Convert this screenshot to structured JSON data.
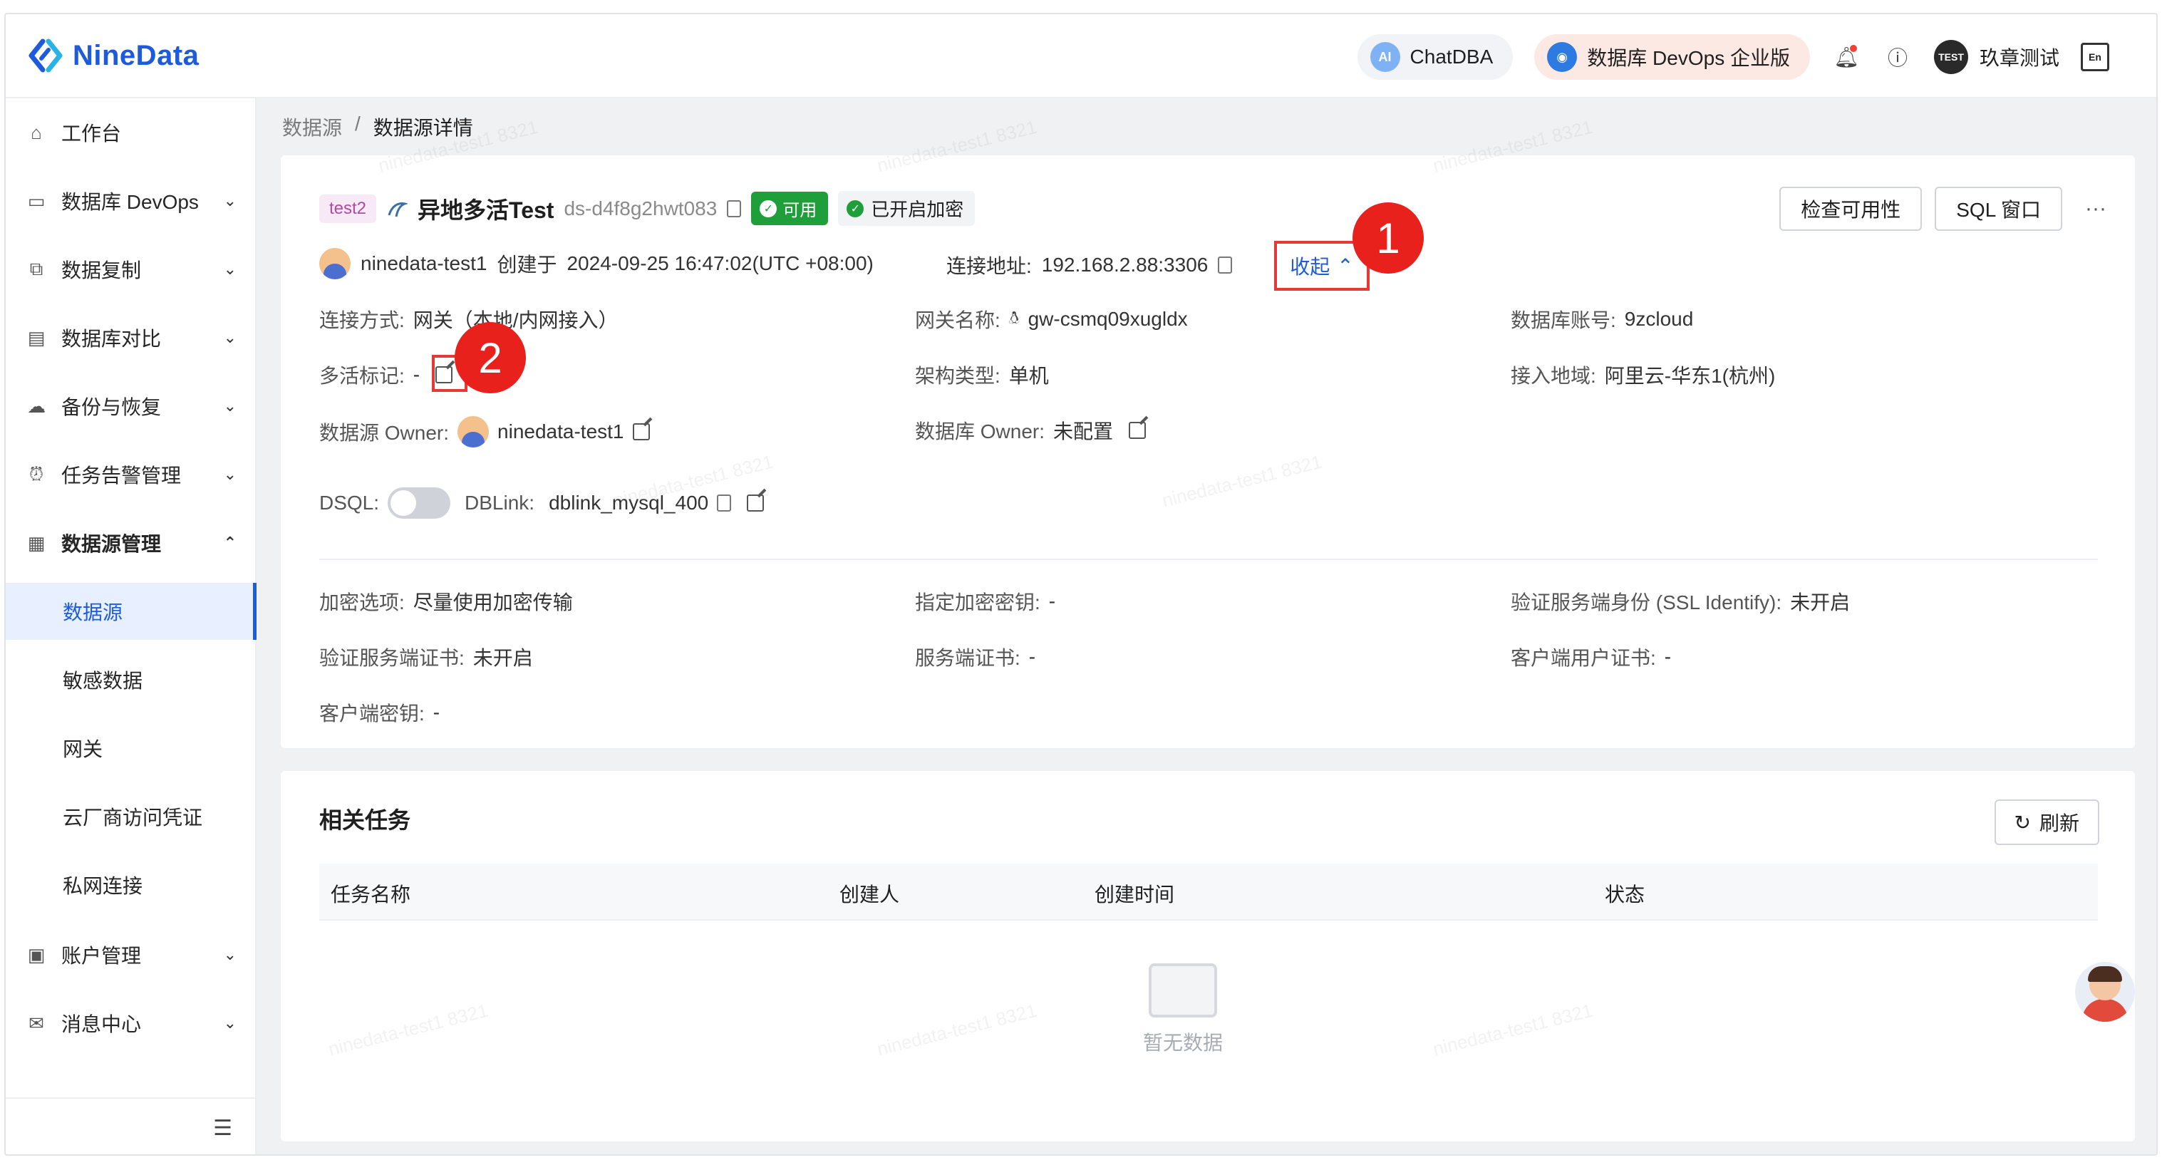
{
  "brand": {
    "name": "NineData"
  },
  "topbar": {
    "chatdba_label": "ChatDBA",
    "chatdba_badge": "AI",
    "devops_label": "数据库 DevOps 企业版",
    "user_badge": "TEST",
    "user_name": "玖章测试"
  },
  "sidebar": {
    "items": [
      {
        "label": "工作台",
        "icon": "home-icon",
        "chevron": ""
      },
      {
        "label": "数据库 DevOps",
        "icon": "devops-icon",
        "chevron": "⌄"
      },
      {
        "label": "数据复制",
        "icon": "replication-icon",
        "chevron": "⌄"
      },
      {
        "label": "数据库对比",
        "icon": "compare-icon",
        "chevron": "⌄"
      },
      {
        "label": "备份与恢复",
        "icon": "backup-icon",
        "chevron": "⌄"
      },
      {
        "label": "任务告警管理",
        "icon": "alarm-icon",
        "chevron": "⌄"
      },
      {
        "label": "数据源管理",
        "icon": "datasource-icon",
        "chevron": "⌃"
      }
    ],
    "sub_items": [
      {
        "label": "数据源",
        "active": true
      },
      {
        "label": "敏感数据"
      },
      {
        "label": "网关"
      },
      {
        "label": "云厂商访问凭证"
      },
      {
        "label": "私网连接"
      }
    ],
    "bottom_items": [
      {
        "label": "账户管理",
        "icon": "account-icon",
        "chevron": "⌄"
      },
      {
        "label": "消息中心",
        "icon": "mail-icon",
        "chevron": "⌄"
      }
    ]
  },
  "breadcrumb": {
    "root": "数据源",
    "sep": "/",
    "current": "数据源详情"
  },
  "datasource": {
    "env_tag": "test2",
    "name": "异地多活Test",
    "id": "ds-d4f8g2hwt083",
    "status": "可用",
    "encryption": "已开启加密",
    "creator": "ninedata-test1",
    "created_label": "创建于",
    "created_at": "2024-09-25 16:47:02(UTC +08:00)",
    "conn_label": "连接地址:",
    "conn_addr": "192.168.2.88:3306",
    "collapse_label": "收起"
  },
  "header_buttons": {
    "check": "检查可用性",
    "sql": "SQL 窗口",
    "more": "···"
  },
  "fields": {
    "conn_mode": {
      "label": "连接方式:",
      "value": "网关（本地/内网接入）"
    },
    "gateway": {
      "label": "网关名称:",
      "value": "gw-csmq09xugldx"
    },
    "db_account": {
      "label": "数据库账号:",
      "value": "9zcloud"
    },
    "multi_active": {
      "label": "多活标记:",
      "value": "-"
    },
    "arch_type": {
      "label": "架构类型:",
      "value": "单机"
    },
    "region": {
      "label": "接入地域:",
      "value": "阿里云-华东1(杭州)"
    },
    "ds_owner": {
      "label": "数据源 Owner:",
      "value": "ninedata-test1"
    },
    "db_owner": {
      "label": "数据库 Owner:",
      "value": "未配置"
    },
    "dsql": {
      "label": "DSQL:"
    },
    "dblink": {
      "label": "DBLink:",
      "value": "dblink_mysql_400"
    },
    "enc_option": {
      "label": "加密选项:",
      "value": "尽量使用加密传输"
    },
    "enc_key": {
      "label": "指定加密密钥:",
      "value": "-"
    },
    "ssl_identify": {
      "label": "验证服务端身份 (SSL Identify):",
      "value": "未开启"
    },
    "server_cert_verify": {
      "label": "验证服务端证书:",
      "value": "未开启"
    },
    "server_cert": {
      "label": "服务端证书:",
      "value": "-"
    },
    "client_cert": {
      "label": "客户端用户证书:",
      "value": "-"
    },
    "client_key": {
      "label": "客户端密钥:",
      "value": "-"
    }
  },
  "annotations": {
    "mark1": "1",
    "mark2": "2",
    "color": "#e8211d"
  },
  "tasks": {
    "title": "相关任务",
    "refresh": "刷新",
    "columns": [
      "任务名称",
      "创建人",
      "创建时间",
      "状态"
    ],
    "empty_text": "暂无数据"
  },
  "watermark_text": "ninedata-test1 8321",
  "colors": {
    "brand": "#1d5bdc",
    "success": "#1f9f3a",
    "annotation": "#e53935"
  }
}
